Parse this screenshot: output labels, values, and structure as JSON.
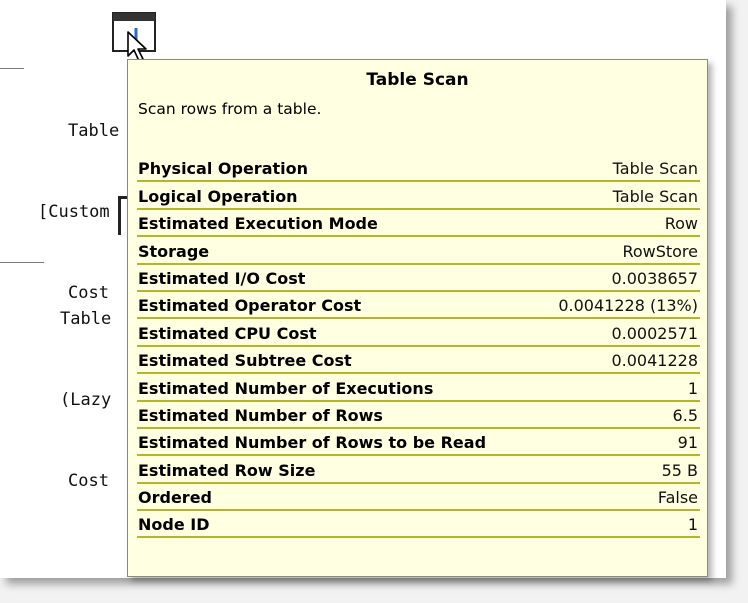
{
  "plan": {
    "node_top_lines": [
      "Table",
      "[Custom",
      "Cost"
    ],
    "node_bottom_lines": [
      "Table",
      "(Lazy",
      "Cost"
    ]
  },
  "tooltip": {
    "title": "Table Scan",
    "description": "Scan rows from a table.",
    "rows": [
      {
        "label": "Physical Operation",
        "value": "Table Scan"
      },
      {
        "label": "Logical Operation",
        "value": "Table Scan"
      },
      {
        "label": "Estimated Execution Mode",
        "value": "Row"
      },
      {
        "label": "Storage",
        "value": "RowStore"
      },
      {
        "label": "Estimated I/O Cost",
        "value": "0.0038657"
      },
      {
        "label": "Estimated Operator Cost",
        "value": "0.0041228 (13%)"
      },
      {
        "label": "Estimated CPU Cost",
        "value": "0.0002571"
      },
      {
        "label": "Estimated Subtree Cost",
        "value": "0.0041228"
      },
      {
        "label": "Estimated Number of Executions",
        "value": "1"
      },
      {
        "label": "Estimated Number of Rows",
        "value": "6.5"
      },
      {
        "label": "Estimated Number of Rows to be Read",
        "value": "91"
      },
      {
        "label": "Estimated Row Size",
        "value": "55 B"
      },
      {
        "label": "Ordered",
        "value": "False"
      },
      {
        "label": "Node ID",
        "value": "1"
      }
    ]
  },
  "colors": {
    "tooltip_bg": "#ffffe1",
    "row_separator": "#b5b52a"
  }
}
